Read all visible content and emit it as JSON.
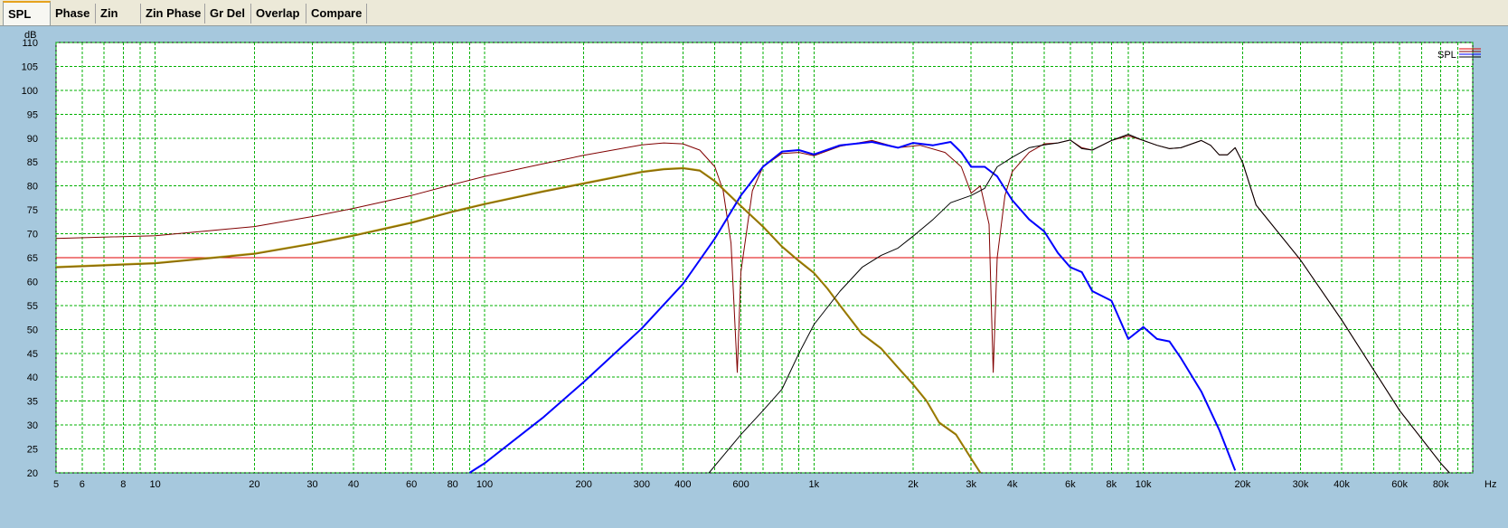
{
  "tabs": [
    {
      "label": "SPL",
      "active": true
    },
    {
      "label": "Phase"
    },
    {
      "label": "Zin"
    },
    {
      "label": "Zin Phase"
    },
    {
      "label": "Gr Del"
    },
    {
      "label": "Overlap"
    },
    {
      "label": "Compare"
    }
  ],
  "chart_data": {
    "type": "line",
    "xscale": "log",
    "xlim": [
      5,
      100000
    ],
    "ylim": [
      20,
      110
    ],
    "xlabel": "Hz",
    "ylabel": "dB",
    "grid": true,
    "legend": {
      "label": "SPL",
      "placement": "top-right"
    },
    "x_ticks": [
      {
        "v": 5,
        "l": "5"
      },
      {
        "v": 6,
        "l": "6"
      },
      {
        "v": 8,
        "l": "8"
      },
      {
        "v": 10,
        "l": "10"
      },
      {
        "v": 20,
        "l": "20"
      },
      {
        "v": 30,
        "l": "30"
      },
      {
        "v": 40,
        "l": "40"
      },
      {
        "v": 60,
        "l": "60"
      },
      {
        "v": 80,
        "l": "80"
      },
      {
        "v": 100,
        "l": "100"
      },
      {
        "v": 200,
        "l": "200"
      },
      {
        "v": 300,
        "l": "300"
      },
      {
        "v": 400,
        "l": "400"
      },
      {
        "v": 600,
        "l": "600"
      },
      {
        "v": 1000,
        "l": "1k"
      },
      {
        "v": 2000,
        "l": "2k"
      },
      {
        "v": 3000,
        "l": "3k"
      },
      {
        "v": 4000,
        "l": "4k"
      },
      {
        "v": 6000,
        "l": "6k"
      },
      {
        "v": 8000,
        "l": "8k"
      },
      {
        "v": 10000,
        "l": "10k"
      },
      {
        "v": 20000,
        "l": "20k"
      },
      {
        "v": 30000,
        "l": "30k"
      },
      {
        "v": 40000,
        "l": "40k"
      },
      {
        "v": 60000,
        "l": "60k"
      },
      {
        "v": 80000,
        "l": "80k"
      }
    ],
    "y_ticks": [
      20,
      25,
      30,
      35,
      40,
      45,
      50,
      55,
      60,
      65,
      70,
      75,
      80,
      85,
      90,
      95,
      100,
      105,
      110
    ],
    "reference_line": {
      "y": 65,
      "color": "#e00000"
    },
    "series": [
      {
        "color": "#800000",
        "width": 1,
        "points": [
          [
            5,
            69
          ],
          [
            10,
            69.6
          ],
          [
            20,
            71.5
          ],
          [
            30,
            73.6
          ],
          [
            40,
            75.3
          ],
          [
            60,
            78
          ],
          [
            80,
            80.3
          ],
          [
            100,
            82
          ],
          [
            150,
            84.6
          ],
          [
            200,
            86.4
          ],
          [
            300,
            88.6
          ],
          [
            350,
            89
          ],
          [
            400,
            88.8
          ],
          [
            450,
            87.5
          ],
          [
            500,
            84
          ],
          [
            530,
            79
          ],
          [
            560,
            68
          ],
          [
            585,
            41
          ],
          [
            600,
            62
          ],
          [
            650,
            79
          ],
          [
            700,
            84
          ],
          [
            800,
            86.8
          ],
          [
            900,
            87
          ],
          [
            1000,
            86.3
          ],
          [
            1200,
            88.3
          ],
          [
            1500,
            89.5
          ],
          [
            1800,
            88
          ],
          [
            2100,
            88.5
          ],
          [
            2500,
            87
          ],
          [
            2800,
            84
          ],
          [
            3000,
            78.5
          ],
          [
            3200,
            80
          ],
          [
            3400,
            72
          ],
          [
            3500,
            41
          ],
          [
            3600,
            65
          ],
          [
            3800,
            78
          ],
          [
            4000,
            83
          ],
          [
            4500,
            87
          ],
          [
            5000,
            88.8
          ],
          [
            5500,
            89
          ],
          [
            6000,
            89.6
          ],
          [
            6500,
            88
          ],
          [
            7000,
            87.5
          ],
          [
            8000,
            89.5
          ],
          [
            9000,
            90.5
          ],
          [
            10000,
            89.5
          ],
          [
            11000,
            88.5
          ],
          [
            12000,
            87.8
          ],
          [
            13000,
            88
          ],
          [
            15000,
            89.5
          ],
          [
            16000,
            88.5
          ],
          [
            17000,
            86.5
          ],
          [
            18000,
            86.5
          ],
          [
            19000,
            88
          ],
          [
            20000,
            85
          ],
          [
            22000,
            76
          ],
          [
            30000,
            64.5
          ],
          [
            40000,
            52
          ],
          [
            60000,
            33
          ],
          [
            80000,
            22
          ],
          [
            85000,
            20
          ]
        ]
      },
      {
        "color": "#8c6a00",
        "width": 2,
        "points": [
          [
            5,
            63
          ],
          [
            10,
            63.8
          ],
          [
            20,
            65.8
          ],
          [
            30,
            67.9
          ],
          [
            40,
            69.6
          ],
          [
            60,
            72.3
          ],
          [
            80,
            74.6
          ],
          [
            100,
            76.2
          ],
          [
            150,
            78.8
          ],
          [
            200,
            80.5
          ],
          [
            300,
            82.9
          ],
          [
            350,
            83.5
          ],
          [
            400,
            83.7
          ],
          [
            450,
            83.2
          ],
          [
            500,
            81
          ],
          [
            600,
            75.8
          ],
          [
            700,
            71.5
          ],
          [
            800,
            67.3
          ],
          [
            900,
            64.3
          ],
          [
            1000,
            61.8
          ],
          [
            1100,
            58.5
          ],
          [
            1200,
            55
          ],
          [
            1400,
            49
          ],
          [
            1600,
            46
          ],
          [
            1800,
            42
          ],
          [
            2000,
            38.5
          ],
          [
            2200,
            35
          ],
          [
            2400,
            30.5
          ],
          [
            2700,
            28
          ],
          [
            3000,
            23
          ],
          [
            3200,
            20
          ]
        ]
      },
      {
        "color": "#0000ff",
        "width": 2,
        "points": [
          [
            90,
            20
          ],
          [
            100,
            22
          ],
          [
            150,
            31.5
          ],
          [
            200,
            39
          ],
          [
            300,
            50.2
          ],
          [
            400,
            59.5
          ],
          [
            500,
            69
          ],
          [
            600,
            78
          ],
          [
            700,
            84
          ],
          [
            800,
            87.2
          ],
          [
            900,
            87.5
          ],
          [
            1000,
            86.6
          ],
          [
            1200,
            88.5
          ],
          [
            1500,
            89.2
          ],
          [
            1800,
            88
          ],
          [
            2000,
            89
          ],
          [
            2300,
            88.5
          ],
          [
            2600,
            89.2
          ],
          [
            2800,
            87
          ],
          [
            3000,
            84
          ],
          [
            3300,
            84
          ],
          [
            3600,
            82
          ],
          [
            4000,
            77
          ],
          [
            4500,
            73
          ],
          [
            5000,
            70.5
          ],
          [
            5500,
            66
          ],
          [
            6000,
            63
          ],
          [
            6500,
            62
          ],
          [
            7000,
            58
          ],
          [
            8000,
            56
          ],
          [
            9000,
            48
          ],
          [
            10000,
            50.5
          ],
          [
            11000,
            48
          ],
          [
            12000,
            47.5
          ],
          [
            13000,
            44
          ],
          [
            15000,
            37
          ],
          [
            17000,
            29
          ],
          [
            19000,
            20.5
          ]
        ]
      },
      {
        "color": "#000000",
        "width": 1,
        "points": [
          [
            480,
            20
          ],
          [
            600,
            28
          ],
          [
            700,
            33
          ],
          [
            800,
            37.5
          ],
          [
            900,
            45
          ],
          [
            1000,
            51
          ],
          [
            1200,
            58
          ],
          [
            1400,
            63
          ],
          [
            1600,
            65.5
          ],
          [
            1800,
            67
          ],
          [
            2000,
            69.5
          ],
          [
            2300,
            73
          ],
          [
            2600,
            76.5
          ],
          [
            3000,
            78
          ],
          [
            3300,
            79.5
          ],
          [
            3600,
            84
          ],
          [
            4000,
            86
          ],
          [
            4500,
            88
          ],
          [
            5000,
            88.6
          ],
          [
            5500,
            89
          ],
          [
            6000,
            89.6
          ],
          [
            6500,
            87.8
          ],
          [
            7000,
            87.5
          ],
          [
            8000,
            89.5
          ],
          [
            9000,
            90.8
          ],
          [
            10000,
            89.5
          ],
          [
            11000,
            88.5
          ],
          [
            12000,
            87.8
          ],
          [
            13000,
            88
          ],
          [
            15000,
            89.5
          ],
          [
            16000,
            88.5
          ],
          [
            17000,
            86.5
          ],
          [
            18000,
            86.5
          ],
          [
            19000,
            88
          ],
          [
            20000,
            85
          ],
          [
            22000,
            76
          ],
          [
            30000,
            64.5
          ],
          [
            40000,
            52
          ],
          [
            60000,
            33
          ],
          [
            80000,
            22
          ],
          [
            85000,
            20
          ]
        ]
      }
    ]
  }
}
